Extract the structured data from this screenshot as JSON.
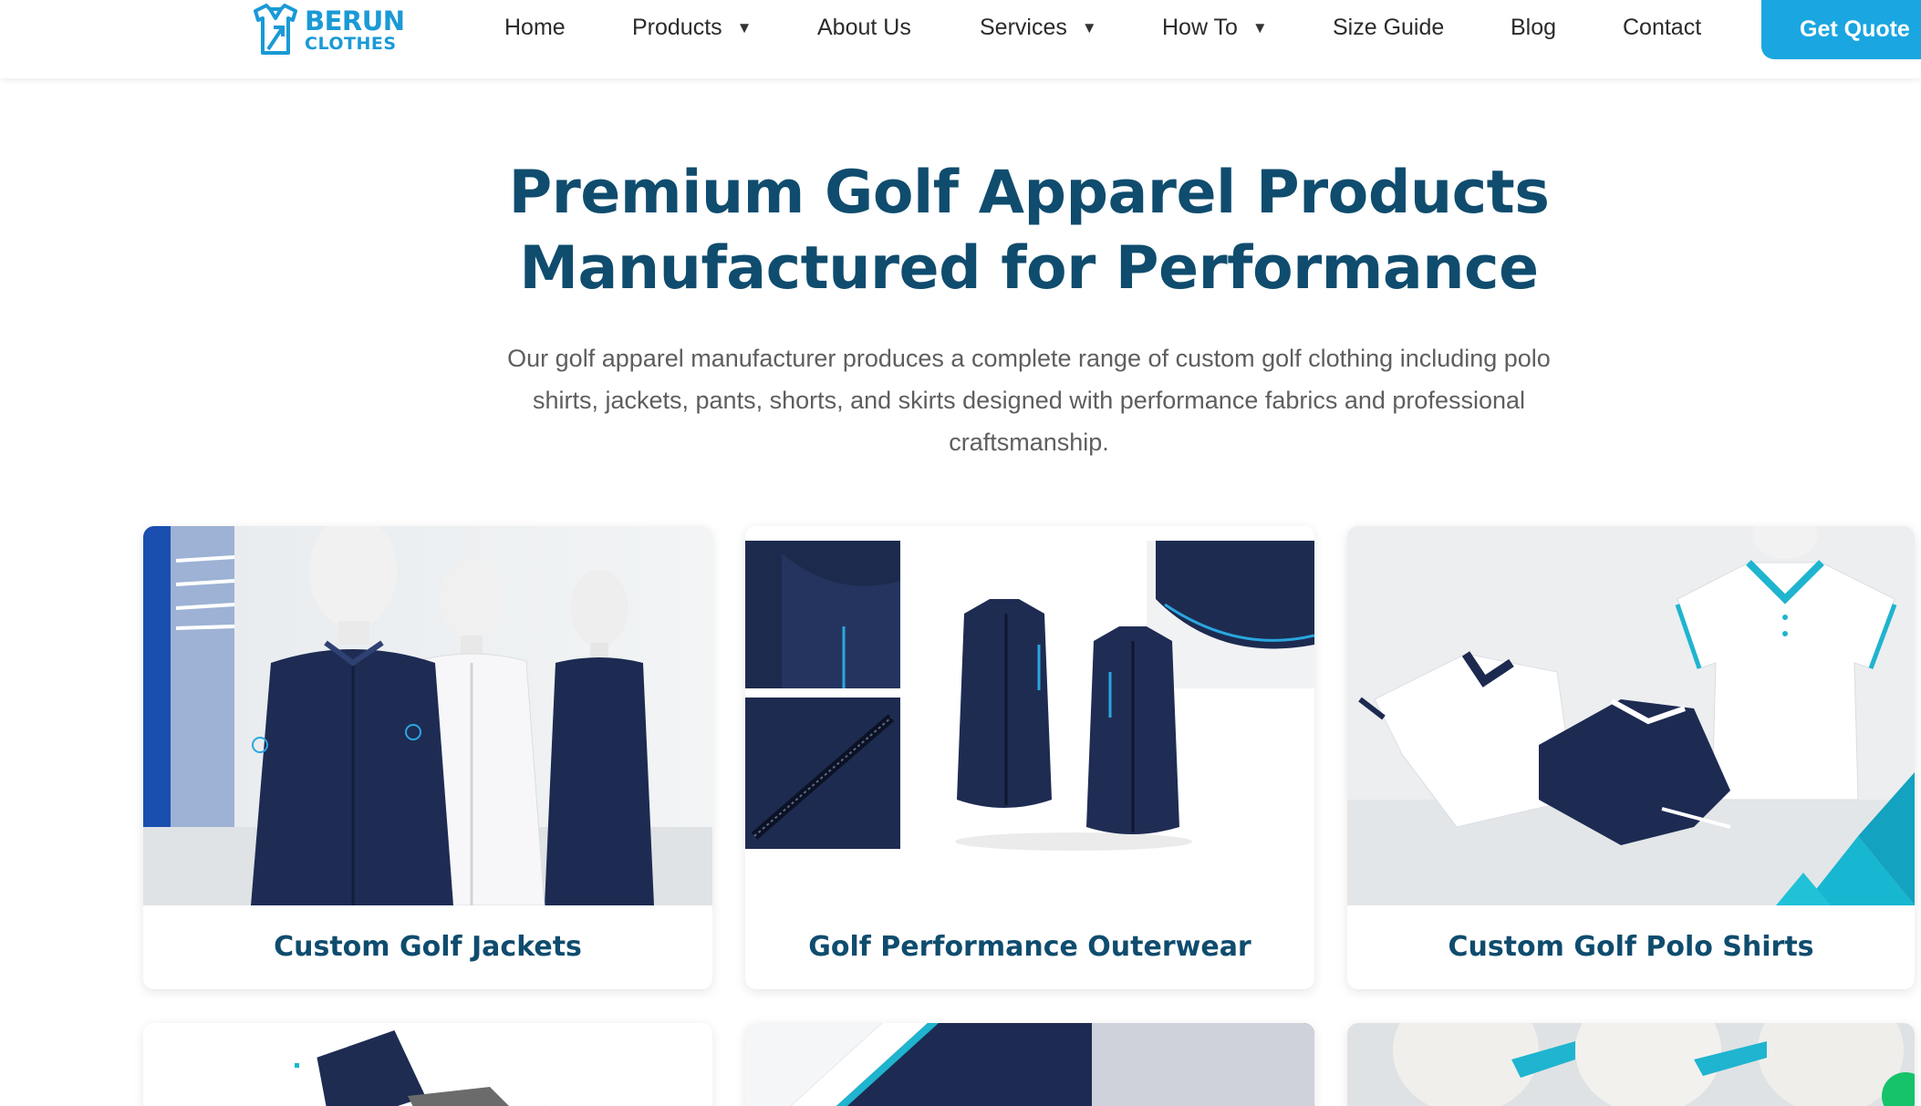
{
  "brand": {
    "name_line1": "BERUN",
    "name_line2": "CLOTHES",
    "accent_color": "#1aa6e0",
    "title_color": "#0f4c6e"
  },
  "nav": {
    "items": [
      {
        "label": "Home"
      },
      {
        "label": "Products",
        "has_dropdown": true
      },
      {
        "label": "About Us"
      },
      {
        "label": "Services",
        "has_dropdown": true
      },
      {
        "label": "How To",
        "has_dropdown": true
      },
      {
        "label": "Size Guide"
      },
      {
        "label": "Blog"
      },
      {
        "label": "Contact"
      }
    ],
    "caret": "▼",
    "cta_label": "Get Quote"
  },
  "hero": {
    "title": "Premium Golf Apparel Products Manufactured for Performance",
    "subtitle": "Our golf apparel manufacturer produces a complete range of custom golf clothing including polo shirts, jackets, pants, shorts, and skirts designed with performance fabrics and professional craftsmanship."
  },
  "products": [
    {
      "label": "Custom Golf Jackets",
      "image": "mannequins-golf-jackets-photo"
    },
    {
      "label": "Golf Performance Outerwear",
      "image": "golf-vests-collage-photo"
    },
    {
      "label": "Custom Golf Polo Shirts",
      "image": "golf-polo-shirts-photo"
    },
    {
      "image": "golf-pants-photo"
    },
    {
      "image": "golf-shorts-photo"
    },
    {
      "image": "golf-skirts-mannequins-photo"
    }
  ]
}
